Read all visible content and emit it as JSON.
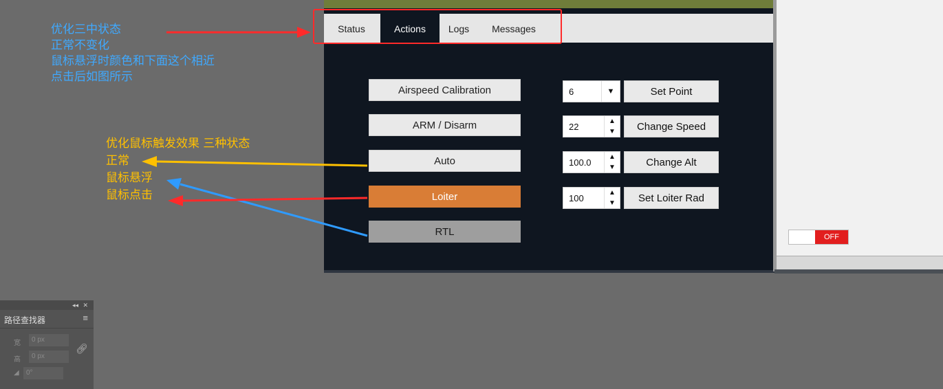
{
  "annotations": {
    "blue_lines": [
      "优化三中状态",
      "正常不变化",
      "鼠标悬浮时颜色和下面这个相近",
      "点击后如图所示"
    ],
    "orange_lines": [
      "优化鼠标触发效果 三种状态",
      "正常",
      "鼠标悬浮",
      "鼠标点击"
    ]
  },
  "tabs": [
    {
      "label": "Status",
      "active": false
    },
    {
      "label": "Actions",
      "active": true
    },
    {
      "label": "Logs",
      "active": false
    },
    {
      "label": "Messages",
      "active": false
    }
  ],
  "actions": {
    "airspeed_calibration": "Airspeed Calibration",
    "arm_disarm": "ARM / Disarm",
    "auto": "Auto",
    "loiter": "Loiter",
    "rtl": "RTL"
  },
  "controls": {
    "set_point": {
      "value": "6",
      "label": "Set Point"
    },
    "change_speed": {
      "value": "22",
      "label": "Change Speed"
    },
    "change_alt": {
      "value": "100.0",
      "label": "Change Alt"
    },
    "set_loiter_rad": {
      "value": "100",
      "label": "Set Loiter Rad"
    }
  },
  "toggle": {
    "label": "OFF"
  },
  "pathfinder": {
    "title": "路径查找器",
    "width_label": "宽",
    "width_value": "0 px",
    "height_label": "高",
    "height_value": "0 px",
    "angle_value": "0°"
  },
  "colors": {
    "annotation_blue": "#3fa9ff",
    "annotation_orange": "#ffc000",
    "highlight_red": "#ff2a2a",
    "hover_orange": "#d97d36",
    "pressed_gray": "#9e9e9e",
    "panel_dark": "#0f1620",
    "toggle_red": "#e21e1e"
  }
}
